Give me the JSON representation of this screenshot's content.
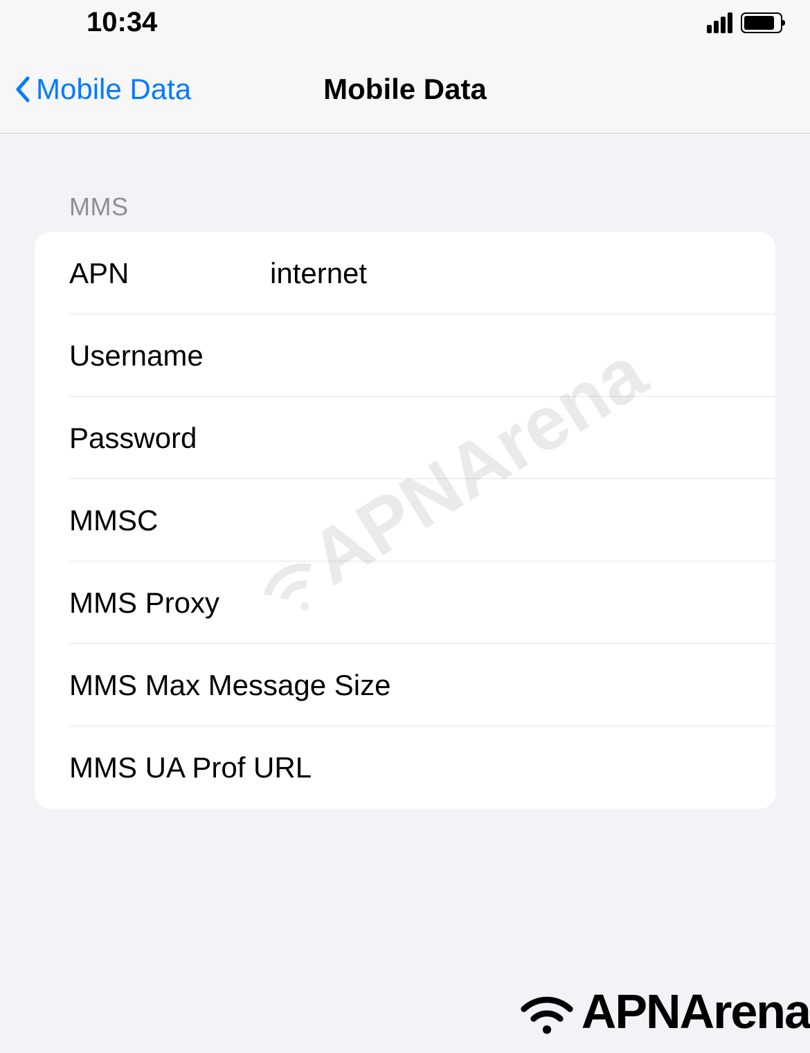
{
  "status_bar": {
    "time": "10:34"
  },
  "nav": {
    "back_label": "Mobile Data",
    "title": "Mobile Data"
  },
  "section_header": "MMS",
  "fields": {
    "apn": {
      "label": "APN",
      "value": "internet"
    },
    "username": {
      "label": "Username",
      "value": ""
    },
    "password": {
      "label": "Password",
      "value": ""
    },
    "mmsc": {
      "label": "MMSC",
      "value": ""
    },
    "mms_proxy": {
      "label": "MMS Proxy",
      "value": ""
    },
    "mms_max_size": {
      "label": "MMS Max Message Size",
      "value": ""
    },
    "mms_ua_prof": {
      "label": "MMS UA Prof URL",
      "value": ""
    }
  },
  "watermark": "APNArena",
  "footer_brand": "APNArena"
}
